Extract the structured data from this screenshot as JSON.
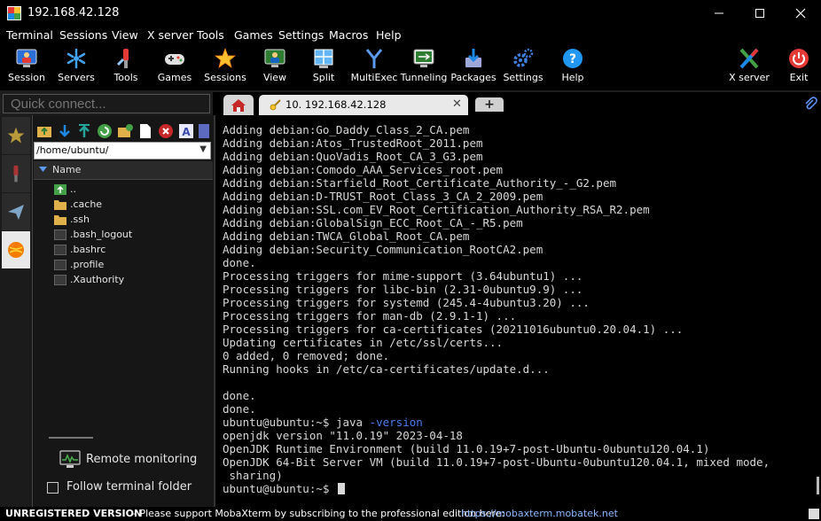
{
  "window": {
    "title": "192.168.42.128"
  },
  "menu": [
    "Terminal",
    "Sessions",
    "View",
    "X server",
    "Tools",
    "Games",
    "Settings",
    "Macros",
    "Help"
  ],
  "toolbar": [
    "Session",
    "Servers",
    "Tools",
    "Games",
    "Sessions",
    "View",
    "Split",
    "MultiExec",
    "Tunneling",
    "Packages",
    "Settings",
    "Help",
    "X server",
    "Exit"
  ],
  "quick_connect": {
    "placeholder": "Quick connect..."
  },
  "tabs": {
    "session_label": "10. 192.168.42.128",
    "close_glyph": "✕",
    "new_tab_glyph": "+"
  },
  "sidebar": {
    "path": "/home/ubuntu/",
    "column_header": "Name",
    "files": [
      "..",
      ".cache",
      ".ssh",
      ".bash_logout",
      ".bashrc",
      ".profile",
      ".Xauthority"
    ],
    "remote_monitoring": "Remote monitoring",
    "follow_terminal": "Follow terminal folder"
  },
  "terminal": {
    "lines": [
      "Adding debian:Go_Daddy_Class_2_CA.pem",
      "Adding debian:Atos_TrustedRoot_2011.pem",
      "Adding debian:QuoVadis_Root_CA_3_G3.pem",
      "Adding debian:Comodo_AAA_Services_root.pem",
      "Adding debian:Starfield_Root_Certificate_Authority_-_G2.pem",
      "Adding debian:D-TRUST_Root_Class_3_CA_2_2009.pem",
      "Adding debian:SSL.com_EV_Root_Certification_Authority_RSA_R2.pem",
      "Adding debian:GlobalSign_ECC_Root_CA_-_R5.pem",
      "Adding debian:TWCA_Global_Root_CA.pem",
      "Adding debian:Security_Communication_RootCA2.pem",
      "done.",
      "Processing triggers for mime-support (3.64ubuntu1) ...",
      "Processing triggers for libc-bin (2.31-0ubuntu9.9) ...",
      "Processing triggers for systemd (245.4-4ubuntu3.20) ...",
      "Processing triggers for man-db (2.9.1-1) ...",
      "Processing triggers for ca-certificates (20211016ubuntu0.20.04.1) ...",
      "Updating certificates in /etc/ssl/certs...",
      "0 added, 0 removed; done.",
      "Running hooks in /etc/ca-certificates/update.d...",
      "",
      "done.",
      "done."
    ],
    "cmd_prompt": "ubuntu@ubuntu:~$ ",
    "cmd_name": "java",
    "cmd_flag": "-version",
    "output": [
      "openjdk version \"11.0.19\" 2023-04-18",
      "OpenJDK Runtime Environment (build 11.0.19+7-post-Ubuntu-0ubuntu120.04.1)",
      "OpenJDK 64-Bit Server VM (build 11.0.19+7-post-Ubuntu-0ubuntu120.04.1, mixed mode,",
      " sharing)"
    ],
    "final_prompt": "ubuntu@ubuntu:~$"
  },
  "status": {
    "unregistered": "UNREGISTERED VERSION",
    "message": "-  Please support MobaXterm by subscribing to the professional edition here:",
    "link": "https://mobaxterm.mobatek.net"
  },
  "colors": {
    "flag": "#4c7cf0",
    "link": "#8fb6ff",
    "folder": "#e0b04a"
  }
}
